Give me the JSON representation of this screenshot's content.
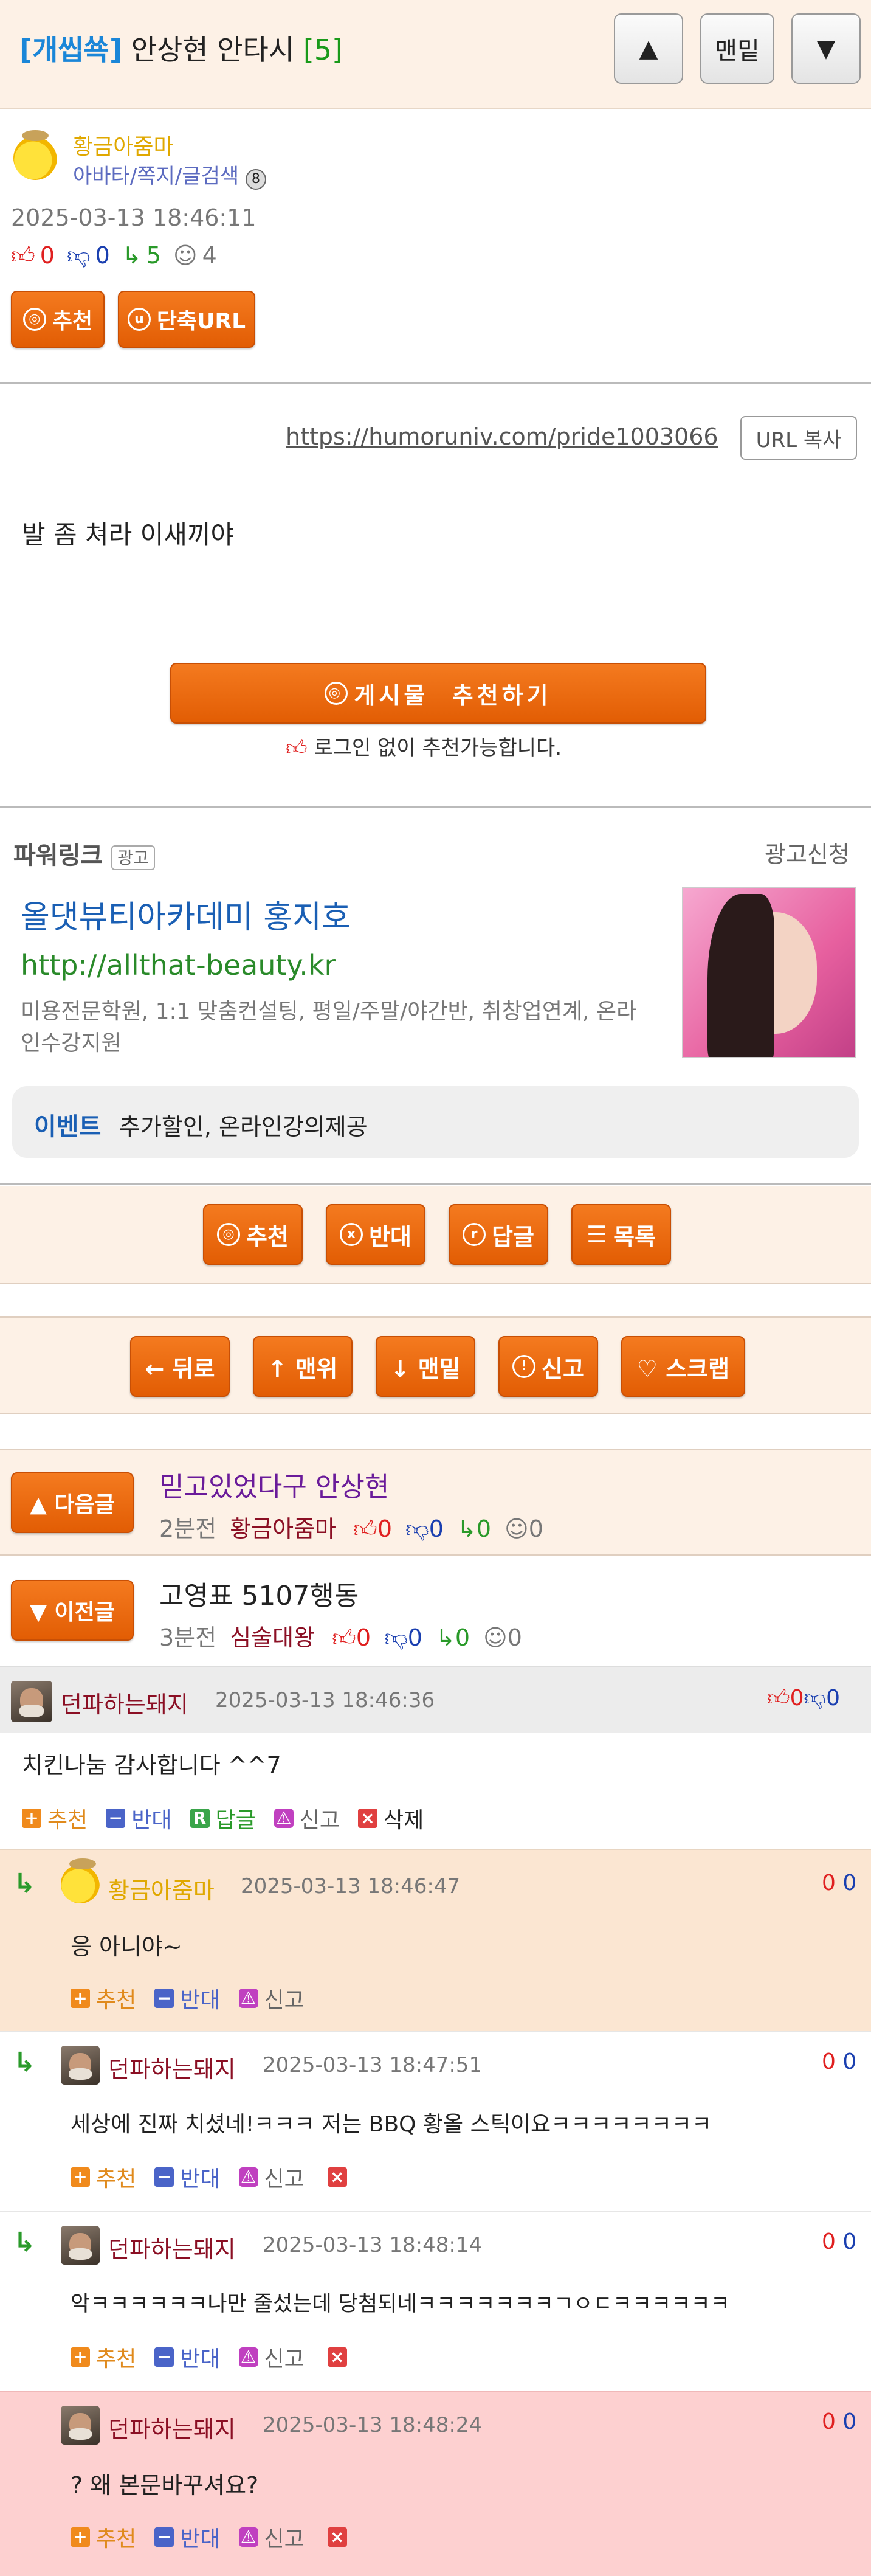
{
  "header": {
    "category": "[개씹쑉]",
    "title": "안상현 안타시",
    "count": "[5]",
    "btn_up": "▲",
    "btn_bottom": "맨밑",
    "btn_down": "▼"
  },
  "author": {
    "name": "황금아줌마",
    "links": "아바타/쪽지/글검색",
    "badge": "8",
    "datetime": "2025-03-13 18:46:11",
    "up": "0",
    "down": "0",
    "replies": "5",
    "views": "4",
    "btn_recommend": "추천",
    "btn_short_url": "단축URL"
  },
  "post": {
    "url": "https://humoruniv.com/pride1003066",
    "copy_btn": "URL 복사",
    "body": "발 좀 쳐라 이새끼야",
    "recommend_btn": "게시물  추천하기",
    "recommend_note": "로그인 없이 추천가능합니다."
  },
  "ad": {
    "label": "파워링크",
    "tag": "광고",
    "apply": "광고신청",
    "title": "올댓뷰티아카데미 홍지호",
    "url": "http://allthat-beauty.kr",
    "desc": "미용전문학원, 1:1 맞춤컨설팅, 평일/주말/야간반, 취창업연계, 온라인수강지원",
    "event_label": "이벤트",
    "event_text": "추가할인, 온라인강의제공"
  },
  "actions1": {
    "recommend": "추천",
    "oppose": "반대",
    "reply": "답글",
    "list": "목록"
  },
  "actions2": {
    "back": "← 뒤로",
    "top": "↑ 맨위",
    "bottom": "↓ 맨밑",
    "report": "신고",
    "scrap": "♡ 스크랩"
  },
  "next_post": {
    "btn": "▲ 다음글",
    "title": "믿고있었다구 안상현",
    "time": "2분전",
    "author": "황금아줌마",
    "up": "0",
    "down": "0",
    "replies": "0",
    "views": "0"
  },
  "prev_post": {
    "btn": "▼ 이전글",
    "title": "고영표 5107행동",
    "time": "3분전",
    "author": "심술대왕",
    "up": "0",
    "down": "0",
    "replies": "0",
    "views": "0"
  },
  "comments": [
    {
      "author": "던파하는돼지",
      "time": "2025-03-13 18:46:36",
      "up": "0",
      "down": "0",
      "text": "치킨나눔 감사합니다 ^^7",
      "rec": "추천",
      "opp": "반대",
      "reply": "답글",
      "report": "신고",
      "delete": "삭제"
    },
    {
      "author": "황금아줌마",
      "time": "2025-03-13 18:46:47",
      "up": "0",
      "down": "0",
      "text": "응 아니야~",
      "rec": "추천",
      "opp": "반대",
      "report": "신고"
    },
    {
      "author": "던파하는돼지",
      "time": "2025-03-13 18:47:51",
      "up": "0",
      "down": "0",
      "text": "세상에 진짜 치셨네!ㅋㅋㅋ 저는 BBQ 황올 스틱이요ㅋㅋㅋㅋㅋㅋㅋㅋ",
      "rec": "추천",
      "opp": "반대",
      "report": "신고"
    },
    {
      "author": "던파하는돼지",
      "time": "2025-03-13 18:48:14",
      "up": "0",
      "down": "0",
      "text": "악ㅋㅋㅋㅋㅋㅋ나만 줄섰는데 당첨되네ㅋㅋㅋㅋㅋㅋㅋㄱㅇㄷㅋㅋㅋㅋㅋㅋ",
      "rec": "추천",
      "opp": "반대",
      "report": "신고"
    },
    {
      "author": "던파하는돼지",
      "time": "2025-03-13 18:48:24",
      "up": "0",
      "down": "0",
      "text": "? 왜 본문바꾸셔요?",
      "rec": "추천",
      "opp": "반대",
      "report": "신고"
    }
  ],
  "colors": {
    "accent": "#e8650a",
    "peach": "#fdf1e6",
    "highlight": "#fdd0d0",
    "reply_bg": "#fbe6d2"
  }
}
